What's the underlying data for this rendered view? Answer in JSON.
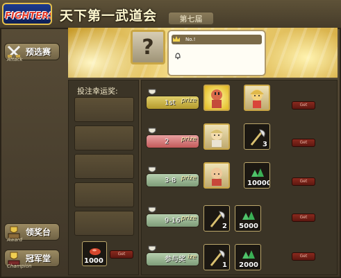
{
  "header": {
    "logo_top": "",
    "logo_text": "FIGHTERS",
    "title": "天下第一武道会",
    "season": "第七届"
  },
  "nav": {
    "prelim_label": "预选赛",
    "prelim_sub": "Attack",
    "award_label": "领奖台",
    "award_sub": "Award",
    "champion_label": "冠军堂",
    "champion_sub": "Champion"
  },
  "banner": {
    "mystery_symbol": "?",
    "rank_text": "No.!"
  },
  "lucky": {
    "title": "投注幸运奖:",
    "item_count": "1000",
    "get_label": "Get"
  },
  "prizes": [
    {
      "rank": "1st",
      "suffix": "prize",
      "color": "#c8b44a",
      "get_label": "Get",
      "item_count": ""
    },
    {
      "rank": "2",
      "suffix": "prize",
      "color": "#d56e6e",
      "get_label": "Get",
      "item_count": "3"
    },
    {
      "rank": "3-8",
      "suffix": "prize",
      "color": "#8fae8a",
      "get_label": "Get",
      "item_count": "10000"
    },
    {
      "rank": "9-16",
      "suffix": "prize",
      "color": "#8fae8a",
      "get_label": "Get",
      "item_count_a": "2",
      "item_count_b": "5000"
    },
    {
      "rank": "参与奖",
      "suffix": "ize",
      "color": "#8fae8a",
      "get_label": "Get",
      "item_count_a": "1",
      "item_count_b": "2000"
    }
  ]
}
